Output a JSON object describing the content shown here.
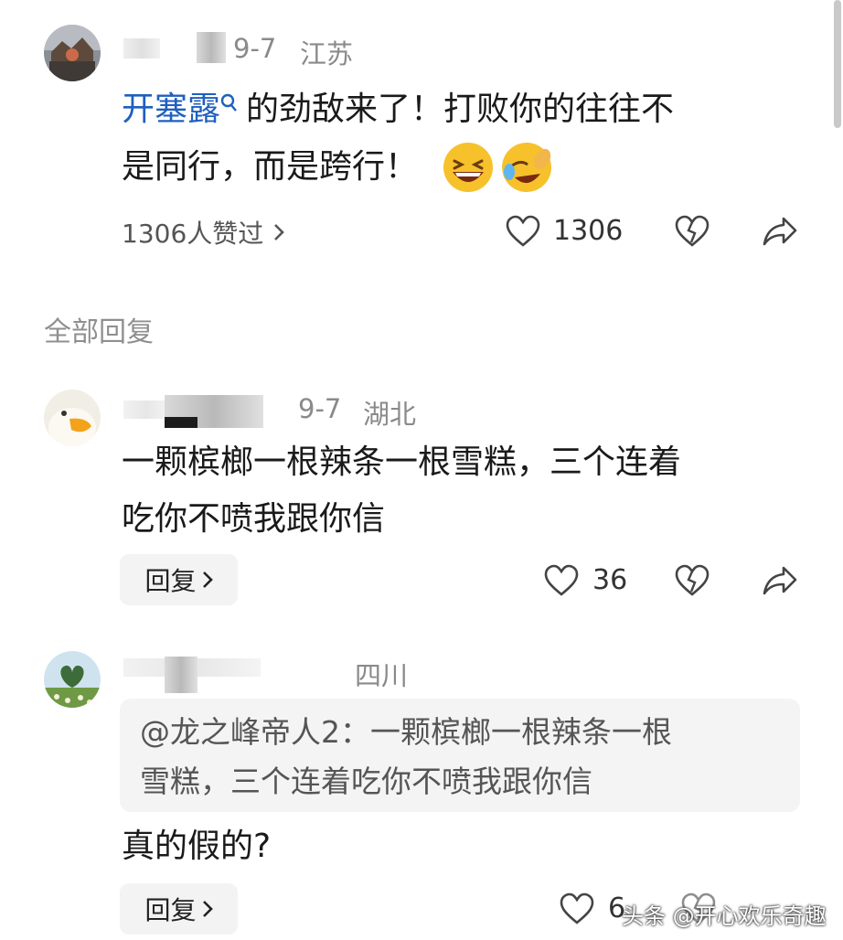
{
  "comments": [
    {
      "date": "9-7",
      "region": "江苏",
      "mention": "开塞露",
      "text_line1": "的劲敌来了！打败你的往往不",
      "text_line2": "是同行，而是跨行！",
      "emojis": [
        "grinning-squinting-face",
        "rolling-on-floor-laughing"
      ],
      "likers_text": "1306人赞过",
      "like_count": "1306"
    }
  ],
  "section_title": "全部回复",
  "replies": [
    {
      "date": "9-7",
      "region": "湖北",
      "text_line1": "一颗槟榔一根辣条一根雪糕，三个连着",
      "text_line2": "吃你不喷我跟你信",
      "reply_label": "回复",
      "like_count": "36"
    },
    {
      "region": "四川",
      "quote_line1": "@龙之峰帝人2：一颗槟榔一根辣条一根",
      "quote_line2": "雪糕，三个连着吃你不喷我跟你信",
      "text": "真的假的?",
      "reply_label": "回复",
      "like_count": "6"
    }
  ],
  "watermark": "头条 @开心欢乐奇趣",
  "icons": {
    "like": "heart-outline-icon",
    "dislike": "broken-heart-icon",
    "share": "share-arrow-icon",
    "search": "search-icon",
    "chevron": "chevron-right-icon"
  },
  "colors": {
    "link": "#1f5fbf",
    "meta": "#8a8a8a",
    "reply_bg": "#f3f3f3"
  }
}
